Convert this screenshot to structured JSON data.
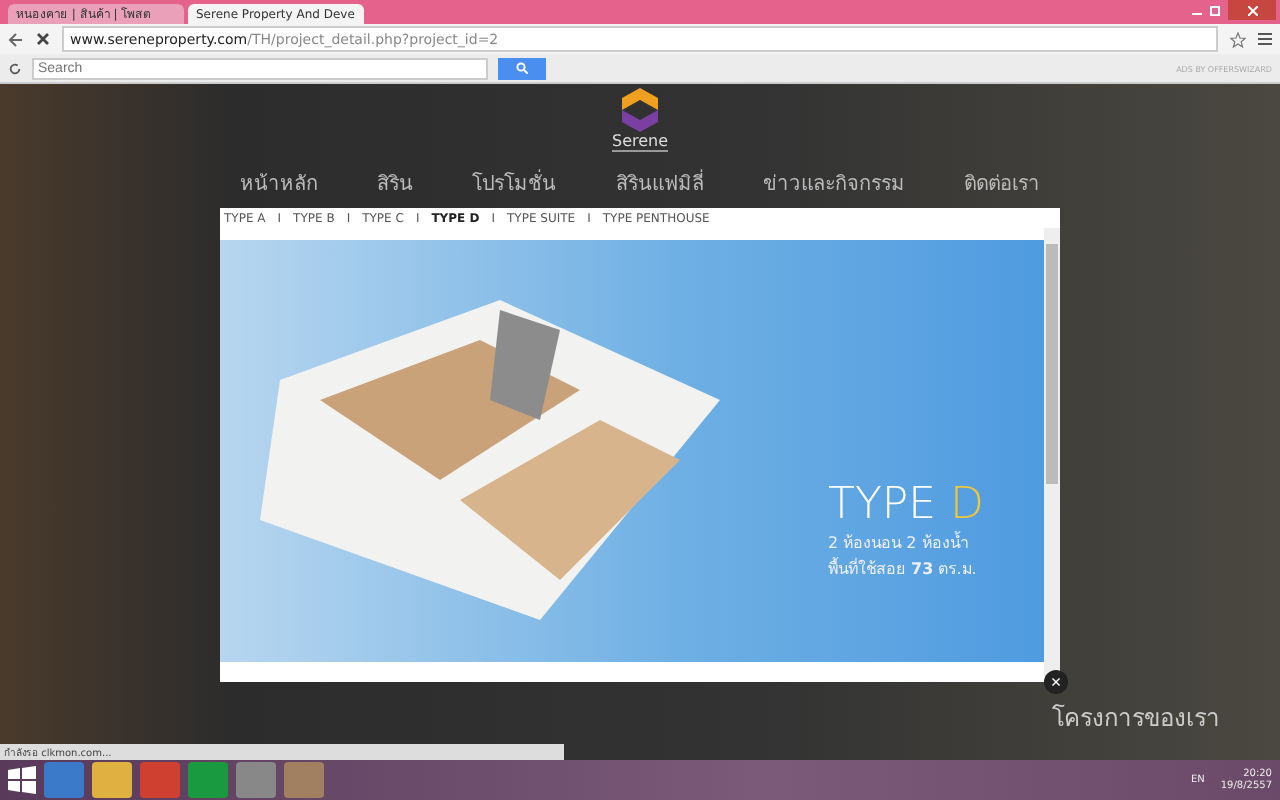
{
  "browser": {
    "tabs": [
      {
        "title": "หนองคาย | สินค้า | โพสต",
        "selected": false
      },
      {
        "title": "Serene Property And Deve",
        "selected": true
      }
    ],
    "url_host": "www.sereneproperty.com",
    "url_path": "/TH/project_detail.php?project_id=2",
    "search": {
      "placeholder": "Search"
    },
    "ads_label": "ADS BY OFFERSWIZARD"
  },
  "site": {
    "logo_text": "Serene",
    "nav": [
      "หน้าหลัก",
      "สิริน",
      "โปรโมชั่น",
      "สิรินแฟมิลี่",
      "ข่าวและกิจกรรม",
      "ติดต่อเรา"
    ],
    "footer_heading": "โครงการของเรา"
  },
  "lightbox": {
    "types": [
      {
        "label": "TYPE A",
        "selected": false
      },
      {
        "separator": "I",
        "label": "TYPE B",
        "selected": false
      },
      {
        "separator": "I",
        "label": "TYPE C",
        "selected": false
      },
      {
        "separator": "I",
        "label": "TYPE D",
        "selected": true
      },
      {
        "separator": "I",
        "label": "TYPE SUITE",
        "selected": false
      },
      {
        "separator": "I",
        "label": "TYPE PENTHOUSE",
        "selected": false
      }
    ],
    "caption_word": "TYPE",
    "caption_letter": "D",
    "caption_line_1": "2 ห้องนอน 2 ห้องน้ำ",
    "caption_line_2_prefix": "พื้นที่ใช้สอย",
    "caption_area": "73",
    "caption_unit": "ตร.ม.",
    "close": "×"
  },
  "status_bar": "กำลังรอ clkmon.com...",
  "taskbar": {
    "language": "EN",
    "time": "20:20",
    "date": "19/8/2557"
  }
}
